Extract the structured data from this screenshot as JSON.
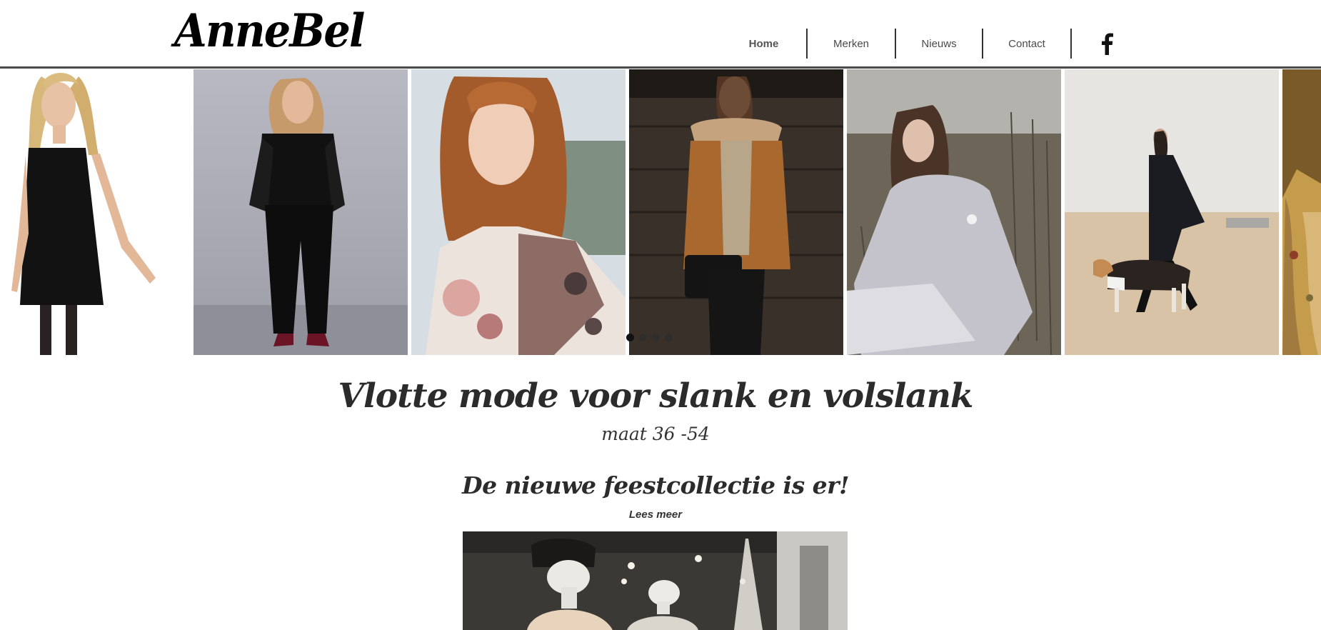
{
  "header": {
    "logo_text": "AnneBel",
    "nav": [
      {
        "label": "Home",
        "active": true
      },
      {
        "label": "Merken",
        "active": false
      },
      {
        "label": "Nieuws",
        "active": false
      },
      {
        "label": "Contact",
        "active": false
      }
    ],
    "social_icon": "facebook-icon"
  },
  "gallery": {
    "slides": [
      "woman-black-sleeveless-dress",
      "woman-black-lace-top-and-trousers",
      "woman-floral-print-blouse",
      "woman-camel-puffer-jacket",
      "woman-grey-padded-coat-in-field",
      "woman-walking-dog-on-beach",
      "woman-fur-coat-partial"
    ],
    "dot_count": 4,
    "active_dot": 1
  },
  "main": {
    "headline": "Vlotte mode voor slank en volslank",
    "subline": "maat 36 -54",
    "promo_title": "De nieuwe feestcollectie is er!",
    "read_more": "Lees meer",
    "promo_image": "boutique-display-mannequins"
  },
  "colors": {
    "text": "#2b2b2b",
    "header_border": "#4a4a4a",
    "nav_text": "#4a4a4a"
  }
}
